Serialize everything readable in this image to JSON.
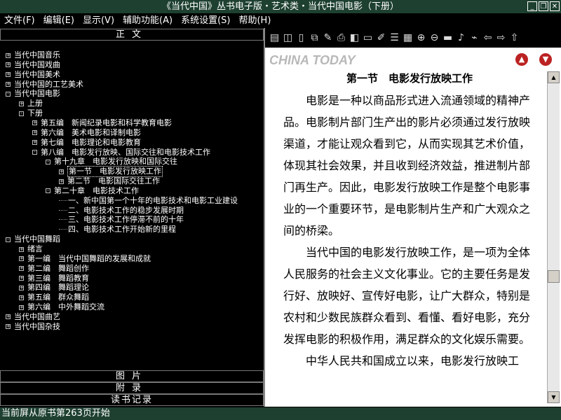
{
  "window": {
    "title": "《当代中国》丛书电子版・艺术类・当代中国电影（下册）"
  },
  "menu": [
    {
      "label": "文件(F)"
    },
    {
      "label": "编辑(E)"
    },
    {
      "label": "显示(V)"
    },
    {
      "label": "辅助功能(A)"
    },
    {
      "label": "系统设置(S)"
    },
    {
      "label": "帮助(H)"
    }
  ],
  "left_panel": {
    "header": "正文",
    "tree": [
      {
        "label": "当代中国音乐",
        "exp": "+"
      },
      {
        "label": "当代中国戏曲",
        "exp": "+"
      },
      {
        "label": "当代中国美术",
        "exp": "+"
      },
      {
        "label": "当代中国的工艺美术",
        "exp": "+"
      },
      {
        "label": "当代中国电影",
        "exp": "-"
      },
      {
        "label": "上册",
        "exp": "+"
      },
      {
        "label": "下册",
        "exp": "-"
      },
      {
        "label": "第五编　新闻纪录电影和科学教育电影",
        "exp": "+"
      },
      {
        "label": "第六编　美术电影和译制电影",
        "exp": "+"
      },
      {
        "label": "第七编　电影理论和电影教育",
        "exp": "+"
      },
      {
        "label": "第八编　电影发行放映、国际交往和电影技术工作",
        "exp": "-"
      },
      {
        "label": "第十九章　电影发行放映和国际交往",
        "exp": "-"
      },
      {
        "label": "第一节　电影发行放映工作",
        "exp": "+"
      },
      {
        "label": "第二节　电影国际交往工作",
        "exp": "+"
      },
      {
        "label": "第二十章　电影技术工作",
        "exp": "-"
      },
      {
        "label": "一、新中国第一个十年的电影技术和电影工业建设",
        "exp": ""
      },
      {
        "label": "二、电影技术工作的稳步发展时期",
        "exp": ""
      },
      {
        "label": "三、电影技术工作停滞不前的十年",
        "exp": ""
      },
      {
        "label": "四、电影技术工作开始新的里程",
        "exp": ""
      },
      {
        "label": "当代中国舞蹈",
        "exp": "-"
      },
      {
        "label": "绪言",
        "exp": "+"
      },
      {
        "label": "第一编　当代中国舞蹈的发展和成就",
        "exp": "+"
      },
      {
        "label": "第二编　舞蹈创作",
        "exp": "+"
      },
      {
        "label": "第三编　舞蹈教育",
        "exp": "+"
      },
      {
        "label": "第四编　舞蹈理论",
        "exp": "+"
      },
      {
        "label": "第五编　群众舞蹈",
        "exp": "+"
      },
      {
        "label": "第六编　中外舞蹈交流",
        "exp": "+"
      },
      {
        "label": "当代中国曲艺",
        "exp": "+"
      },
      {
        "label": "当代中国杂技",
        "exp": "+"
      }
    ],
    "bottom_tabs": [
      {
        "label": "图片"
      },
      {
        "label": "附录"
      },
      {
        "label": "读书记录"
      }
    ]
  },
  "reader": {
    "logo": "CHINA TODAY",
    "heading": "第一节　电影发行放映工作",
    "paragraphs": [
      "电影是一种以商品形式进入流通领域的精神产品。电影制片部门生产出的影片必须通过发行放映渠道，才能让观众看到它，从而实现其艺术价值，体现其社会效果，并且收到经济效益，推进制片部门再生产。因此，电影发行放映工作是整个电影事业的一个重要环节，是电影制片生产和广大观众之间的桥梁。",
      "当代中国的电影发行放映工作，是一项为全体人民服务的社会主义文化事业。它的主要任务是发行好、放映好、宣传好电影，让广大群众，特别是农村和少数民族群众看到、看懂、看好电影，充分发挥电影的积极作用，满足群众的文化娱乐需要。",
      "中华人民共和国成立以来，电影发行放映工"
    ]
  },
  "status": {
    "text": "当前屏从原书第263页开始"
  }
}
